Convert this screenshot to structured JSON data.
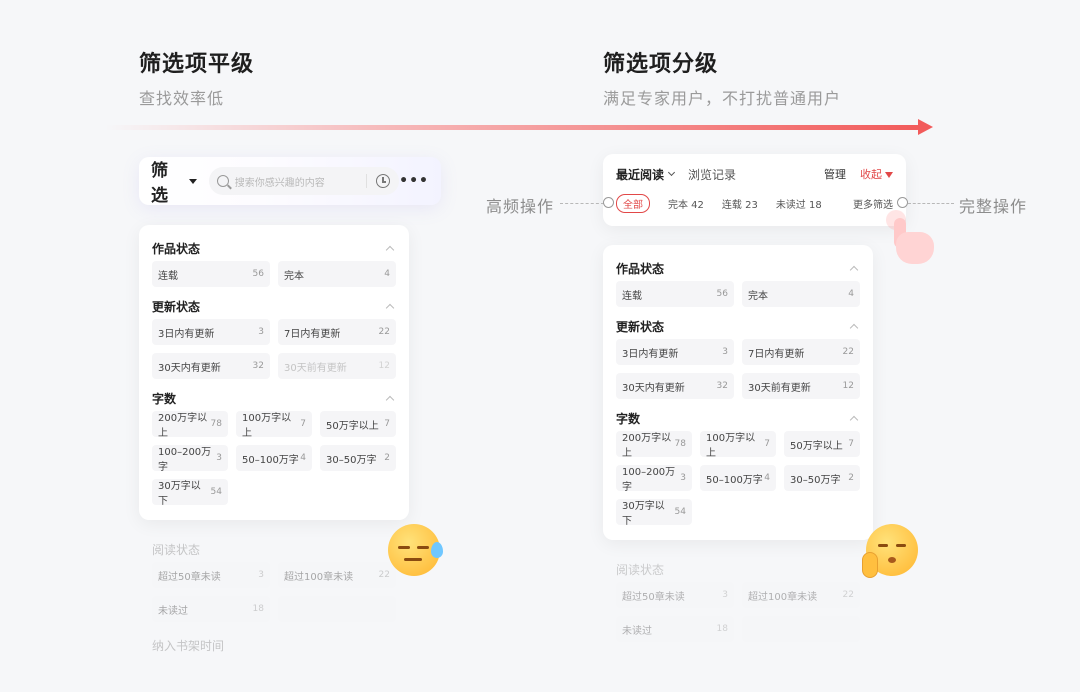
{
  "left": {
    "heading": "筛选项平级",
    "subtitle": "查找效率低",
    "topbar": {
      "title": "筛选",
      "search_placeholder": "搜索你感兴趣的内容",
      "more": "•••"
    },
    "sections": [
      {
        "title": "作品状态",
        "cols": 2,
        "chips": [
          {
            "label": "连载",
            "count": "56"
          },
          {
            "label": "完本",
            "count": "4"
          }
        ]
      },
      {
        "title": "更新状态",
        "cols": 2,
        "chips": [
          {
            "label": "3日内有更新",
            "count": "3"
          },
          {
            "label": "7日内有更新",
            "count": "22"
          },
          {
            "label": "30天内有更新",
            "count": "32"
          },
          {
            "label": "30天前有更新",
            "count": "12",
            "disabled": true
          }
        ]
      },
      {
        "title": "字数",
        "cols": 3,
        "chips": [
          {
            "label": "200万字以上",
            "count": "78"
          },
          {
            "label": "100万字以上",
            "count": "7"
          },
          {
            "label": "50万字以上",
            "count": "7"
          },
          {
            "label": "100–200万字",
            "count": "3"
          },
          {
            "label": "50–100万字",
            "count": "4"
          },
          {
            "label": "30–50万字",
            "count": "2"
          },
          {
            "label": "30万字以下",
            "count": "54"
          }
        ]
      }
    ],
    "faded": {
      "title": "阅读状态",
      "chips": [
        {
          "label": "超过50章未读",
          "count": "3"
        },
        {
          "label": "超过100章未读",
          "count": "22"
        },
        {
          "label": "未读过",
          "count": "18"
        },
        {
          "label": "",
          "count": ""
        }
      ],
      "next_title": "纳入书架时间"
    }
  },
  "right": {
    "heading": "筛选项分级",
    "subtitle": "满足专家用户，不打扰普通用户",
    "topbar": {
      "recent": "最近阅读",
      "history": "浏览记录",
      "manage": "管理",
      "collapse": "收起",
      "quick": [
        {
          "label": "全部",
          "count": ""
        },
        {
          "label": "完本",
          "count": "42"
        },
        {
          "label": "连载",
          "count": "23"
        },
        {
          "label": "未读过",
          "count": "18"
        }
      ],
      "more_filters": "更多筛选"
    },
    "label_left": "高频操作",
    "label_right": "完整操作",
    "sections": [
      {
        "title": "作品状态",
        "chips": [
          {
            "label": "连载",
            "count": "56"
          },
          {
            "label": "完本",
            "count": "4"
          }
        ]
      },
      {
        "title": "更新状态",
        "chips": [
          {
            "label": "3日内有更新",
            "count": "3"
          },
          {
            "label": "7日内有更新",
            "count": "22"
          },
          {
            "label": "30天内有更新",
            "count": "32"
          },
          {
            "label": "30天前有更新",
            "count": "12"
          }
        ]
      },
      {
        "title": "字数",
        "chips": [
          {
            "label": "200万字以上",
            "count": "78"
          },
          {
            "label": "100万字以上",
            "count": "7"
          },
          {
            "label": "50万字以上",
            "count": "7"
          },
          {
            "label": "100–200万字",
            "count": "3"
          },
          {
            "label": "50–100万字",
            "count": "4"
          },
          {
            "label": "30–50万字",
            "count": "2"
          },
          {
            "label": "30万字以下",
            "count": "54"
          }
        ]
      }
    ],
    "faded": {
      "title": "阅读状态",
      "chips": [
        {
          "label": "超过50章未读",
          "count": "3"
        },
        {
          "label": "超过100章未读",
          "count": "22"
        },
        {
          "label": "未读过",
          "count": "18"
        },
        {
          "label": "",
          "count": ""
        }
      ]
    }
  },
  "colors": {
    "accent": "#e24848",
    "arrow": "#f25b5b",
    "chip_bg": "#f5f5f7",
    "background": "#f6f7f9"
  },
  "icons": [
    "search-icon",
    "history-clock-icon",
    "more-dots-icon",
    "caret-down-icon",
    "chevron-up-icon",
    "filter-funnel-icon",
    "tap-hand-icon",
    "sweat-emoji-icon",
    "pleading-emoji-icon"
  ]
}
